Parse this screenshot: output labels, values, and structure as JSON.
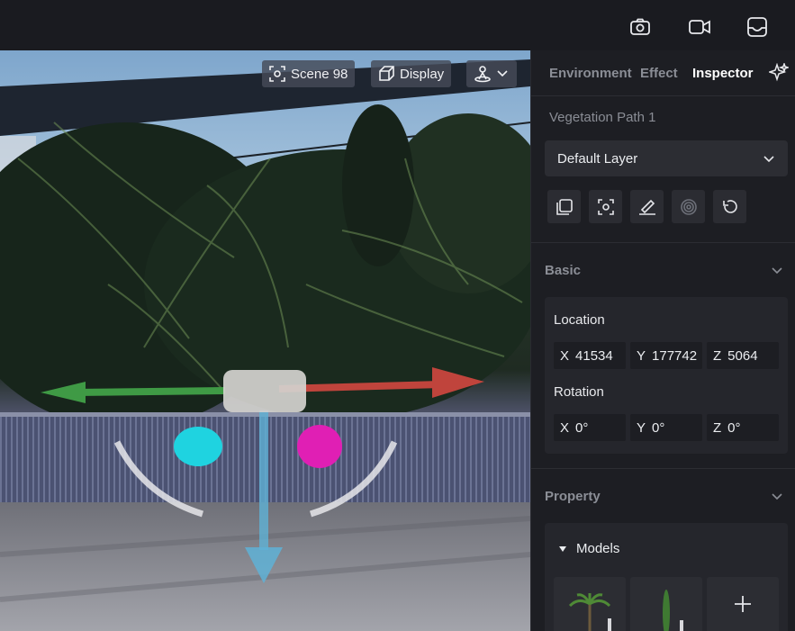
{
  "viewport": {
    "scene_label": "Scene 98",
    "display_label": "Display"
  },
  "panel": {
    "tabs": [
      {
        "label": "Environment"
      },
      {
        "label": "Effect"
      },
      {
        "label": "Inspector"
      }
    ],
    "object_name": "Vegetation Path 1",
    "layer_select": "Default Layer",
    "basic": {
      "title": "Basic",
      "location_label": "Location",
      "location": {
        "x_axis": "X",
        "x": "41534",
        "y_axis": "Y",
        "y": "177742",
        "z_axis": "Z",
        "z": "5064"
      },
      "rotation_label": "Rotation",
      "rotation": {
        "x_axis": "X",
        "x": "0°",
        "y_axis": "Y",
        "y": "0°",
        "z_axis": "Z",
        "z": "0°"
      }
    },
    "property": {
      "title": "Property",
      "models_label": "Models"
    }
  },
  "colors": {
    "gizmo_x": "#c0443c",
    "gizmo_y": "#3f9a45",
    "gizmo_z": "#5fb2d6",
    "handle_cyan": "#1fd3e0",
    "handle_magenta": "#e01fb4"
  }
}
